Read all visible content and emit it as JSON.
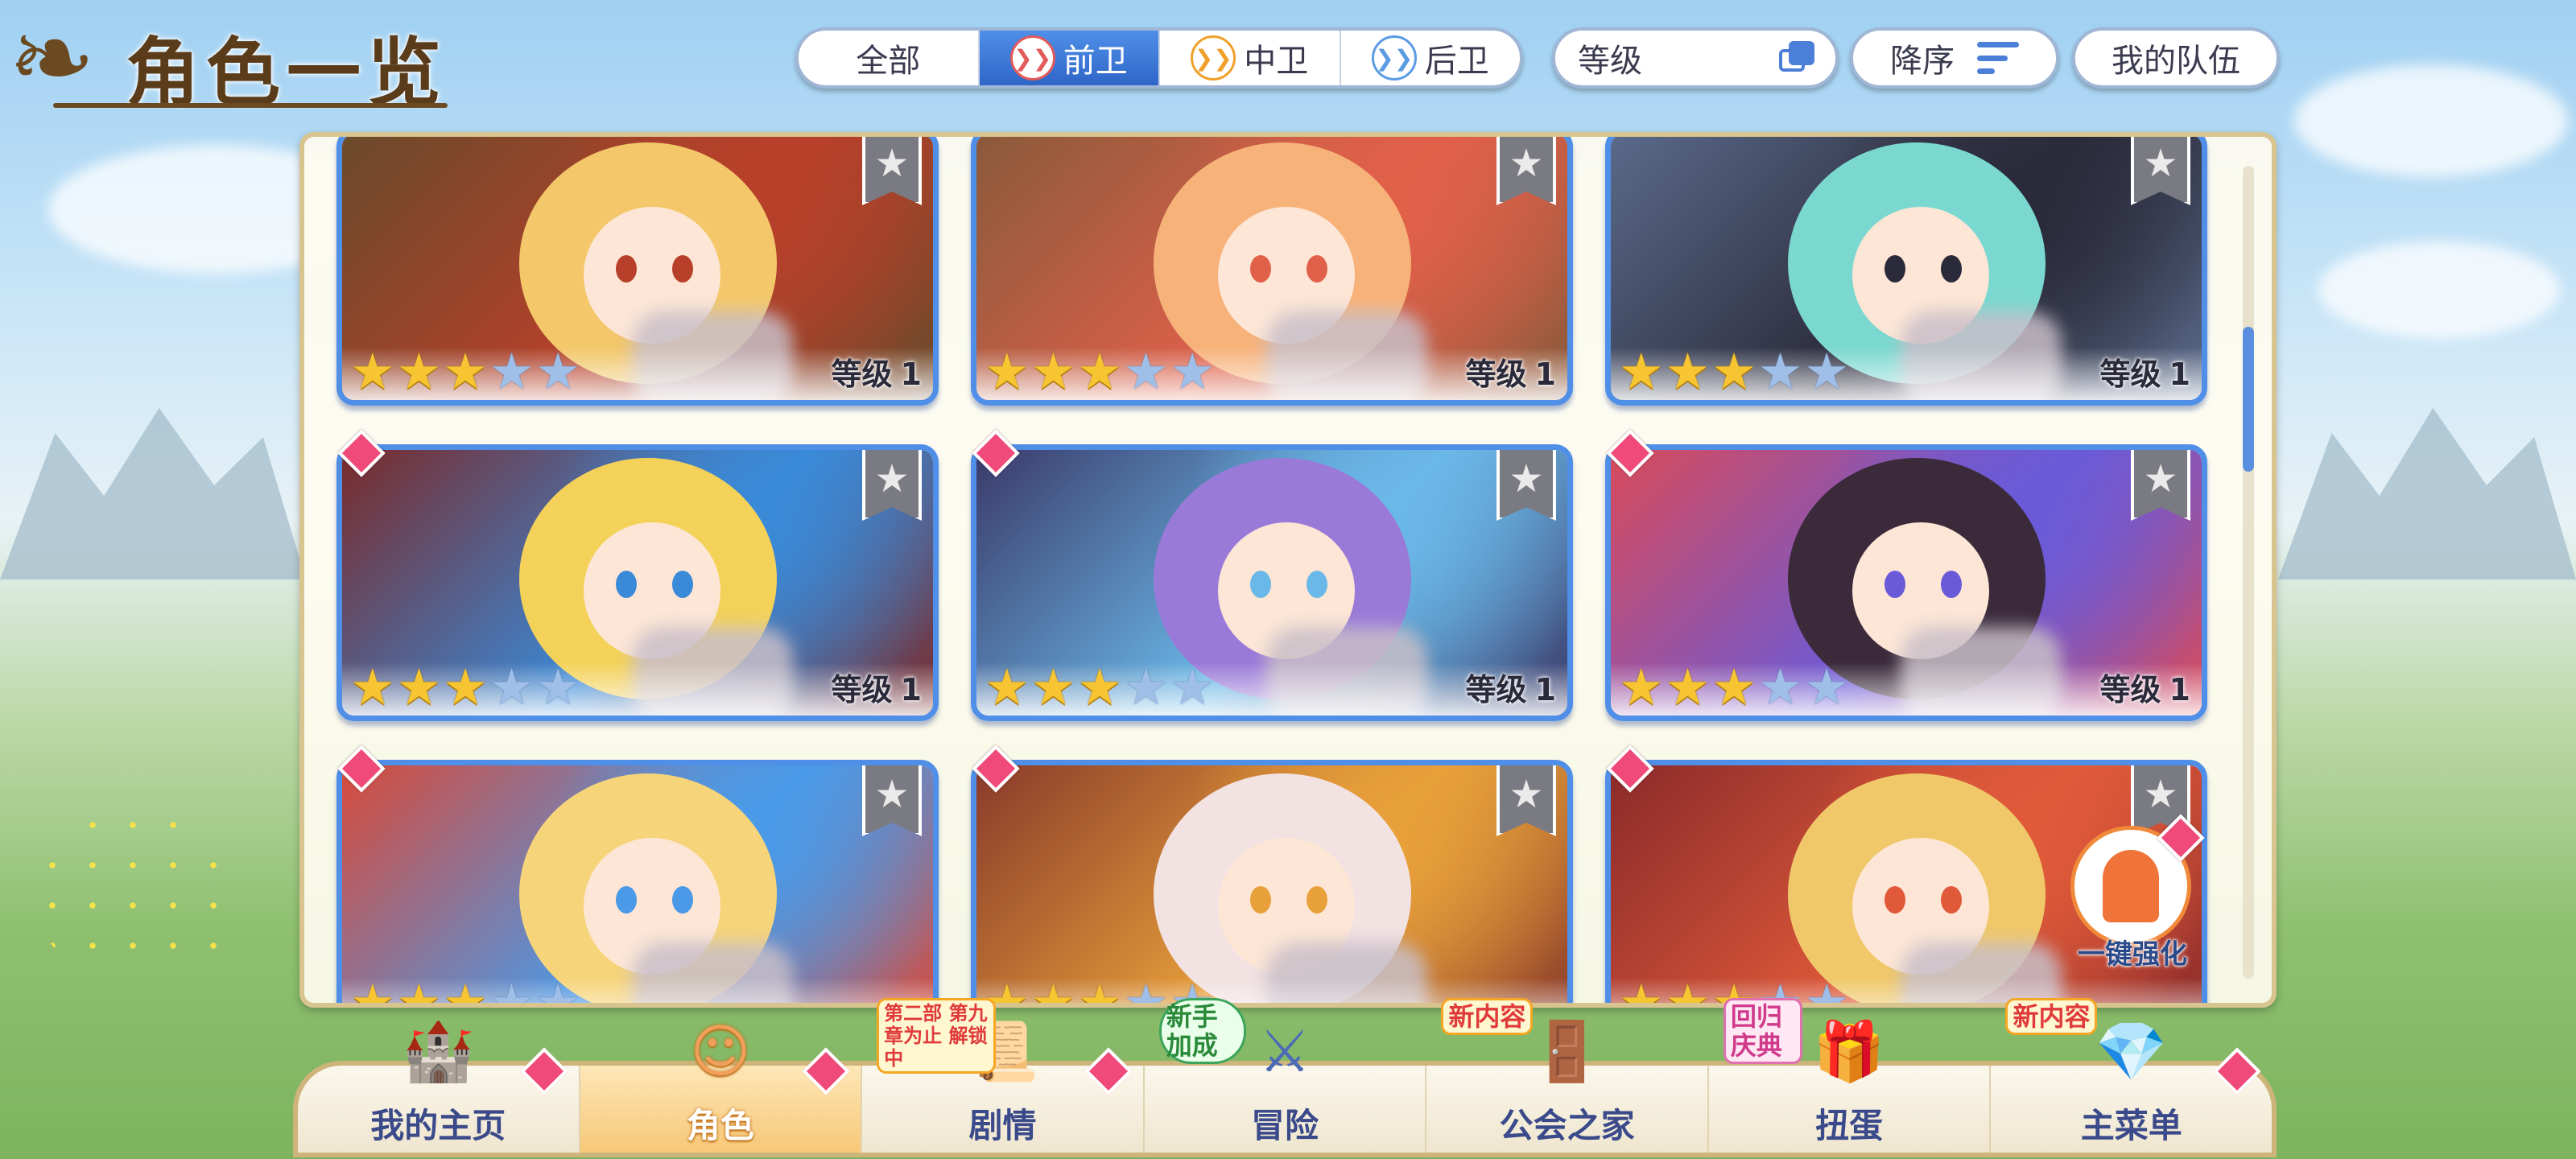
{
  "header": {
    "title": "角色一览"
  },
  "filters": {
    "tabs": [
      {
        "label": "全部",
        "icon": ""
      },
      {
        "label": "前卫",
        "icon": "front-role-icon"
      },
      {
        "label": "中卫",
        "icon": "middle-role-icon"
      },
      {
        "label": "后卫",
        "icon": "back-role-icon"
      }
    ],
    "active_tab": "前卫",
    "sort_field": "等级",
    "sort_order": "降序",
    "team_button": "我的队伍"
  },
  "cards": [
    {
      "stars": 3,
      "max_stars": 5,
      "level_label": "等级",
      "level": "1"
    },
    {
      "stars": 3,
      "max_stars": 5,
      "level_label": "等级",
      "level": "1"
    },
    {
      "stars": 3,
      "max_stars": 5,
      "level_label": "等级",
      "level": "1"
    },
    {
      "stars": 3,
      "max_stars": 5,
      "level_label": "等级",
      "level": "1"
    },
    {
      "stars": 3,
      "max_stars": 5,
      "level_label": "等级",
      "level": "1"
    },
    {
      "stars": 3,
      "max_stars": 5,
      "level_label": "等级",
      "level": "1"
    },
    {
      "stars": 3,
      "max_stars": 5,
      "level_label": "",
      "level": ""
    },
    {
      "stars": 3,
      "max_stars": 5,
      "level_label": "",
      "level": ""
    },
    {
      "stars": 3,
      "max_stars": 5,
      "level_label": "",
      "level": ""
    }
  ],
  "enhance_button": "一键强化",
  "nav": {
    "items": [
      {
        "label": "我的主页",
        "icon": "castle-icon",
        "badge": ""
      },
      {
        "label": "角色",
        "icon": "character-icon",
        "badge": ""
      },
      {
        "label": "剧情",
        "icon": "scroll-icon",
        "badge": "第二部 第九章为止 解锁中"
      },
      {
        "label": "冒险",
        "icon": "sword-shield-icon",
        "badge": "新手 加成"
      },
      {
        "label": "公会之家",
        "icon": "guild-door-icon",
        "badge": "新内容"
      },
      {
        "label": "扭蛋",
        "icon": "gacha-icon",
        "badge": "回归 庆典"
      },
      {
        "label": "主菜单",
        "icon": "crystal-icon",
        "badge": "新内容"
      }
    ],
    "active": "角色"
  },
  "colors": {
    "accent": "#4f8fe8",
    "active_tab": "#2f66c8",
    "star": "#f6c531",
    "gem": "#f04a7a",
    "panel_border": "#d8c48e"
  }
}
